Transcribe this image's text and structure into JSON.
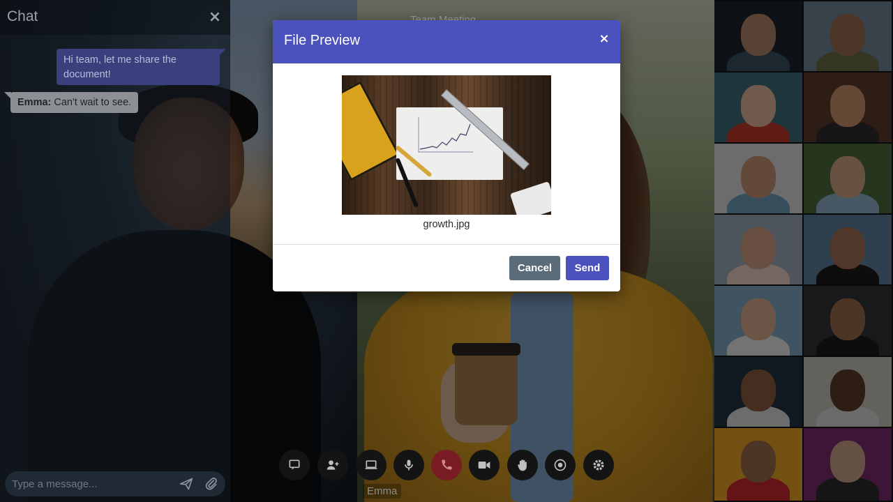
{
  "chat": {
    "title": "Chat",
    "close_icon": "×",
    "messages": [
      {
        "author": "",
        "text": "Hi team, let me share the document!",
        "own": true
      },
      {
        "author": "Emma:",
        "text": "Can't wait to see.",
        "own": false
      }
    ],
    "input_placeholder": "Type a message...",
    "send_icon": "send-icon",
    "attach_icon": "paperclip-icon"
  },
  "meeting": {
    "title": "Team Meeting",
    "speaker_name": "Emma"
  },
  "controls": [
    {
      "name": "chat-toggle-button",
      "icon": "chat-icon"
    },
    {
      "name": "add-participant-button",
      "icon": "user-plus-icon"
    },
    {
      "name": "screen-share-button",
      "icon": "laptop-icon"
    },
    {
      "name": "microphone-button",
      "icon": "microphone-icon"
    },
    {
      "name": "hang-up-button",
      "icon": "phone-icon"
    },
    {
      "name": "camera-button",
      "icon": "video-camera-icon"
    },
    {
      "name": "raise-hand-button",
      "icon": "hand-icon"
    },
    {
      "name": "record-button",
      "icon": "record-icon"
    },
    {
      "name": "settings-button",
      "icon": "gear-icon"
    }
  ],
  "modal": {
    "title": "File Preview",
    "close_icon": "×",
    "file_name": "growth.jpg",
    "cancel_label": "Cancel",
    "send_label": "Send"
  },
  "colors": {
    "accent": "#4b52bd",
    "cancel": "#5a6b7a",
    "hangup": "#7a1c24"
  },
  "participants_count": 12
}
